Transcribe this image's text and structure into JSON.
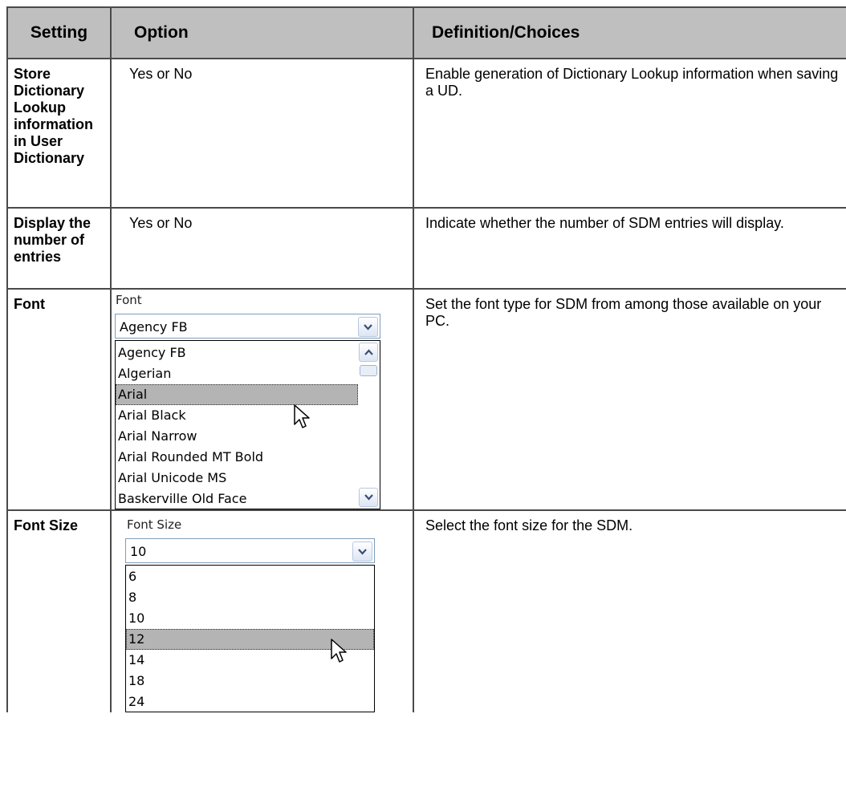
{
  "table": {
    "headers": [
      "Setting",
      "Option",
      "Definition/Choices"
    ],
    "rows": [
      {
        "setting": "Store Dictionary Lookup information in User Dictionary",
        "setting_lines": [
          "Store",
          "Dictionary",
          "Lookup",
          "information",
          "in User",
          "Dictionary"
        ],
        "option": "Yes or No",
        "definition": "Enable generation of Dictionary Lookup information when saving a UD."
      },
      {
        "setting": "Display the number of entries",
        "setting_lines": [
          "Display the",
          "number of",
          "entries"
        ],
        "option": "Yes or No",
        "definition": "Indicate whether the number of SDM entries will display."
      },
      {
        "setting": "Font",
        "setting_lines": [
          "Font"
        ],
        "option_widget": {
          "caption": "Font",
          "selected_value": "Agency FB",
          "list_items": [
            "Agency FB",
            "Algerian",
            "Arial",
            "Arial Black",
            "Arial Narrow",
            "Arial Rounded MT Bold",
            "Arial Unicode MS",
            "Baskerville Old Face"
          ],
          "highlighted_item": "Arial"
        },
        "definition": "Set the font type for SDM from among those available on your PC."
      },
      {
        "setting": "Font Size",
        "setting_lines": [
          "Font Size"
        ],
        "option_widget": {
          "caption": "Font Size",
          "selected_value": "10",
          "list_items": [
            "6",
            "8",
            "10",
            "12",
            "14",
            "18",
            "24"
          ],
          "highlighted_item": "12"
        },
        "definition": "Select the font size for the SDM."
      }
    ]
  },
  "icons": {
    "dropdown": "chevron-down-icon",
    "scroll_up": "chevron-up-icon",
    "scroll_down": "chevron-down-icon",
    "pointer": "mouse-pointer-icon"
  },
  "colors": {
    "header_bg": "#bfbfbf",
    "border": "#4a4a4a",
    "highlight": "#b4b4b4",
    "combo_border": "#7f9db9"
  }
}
